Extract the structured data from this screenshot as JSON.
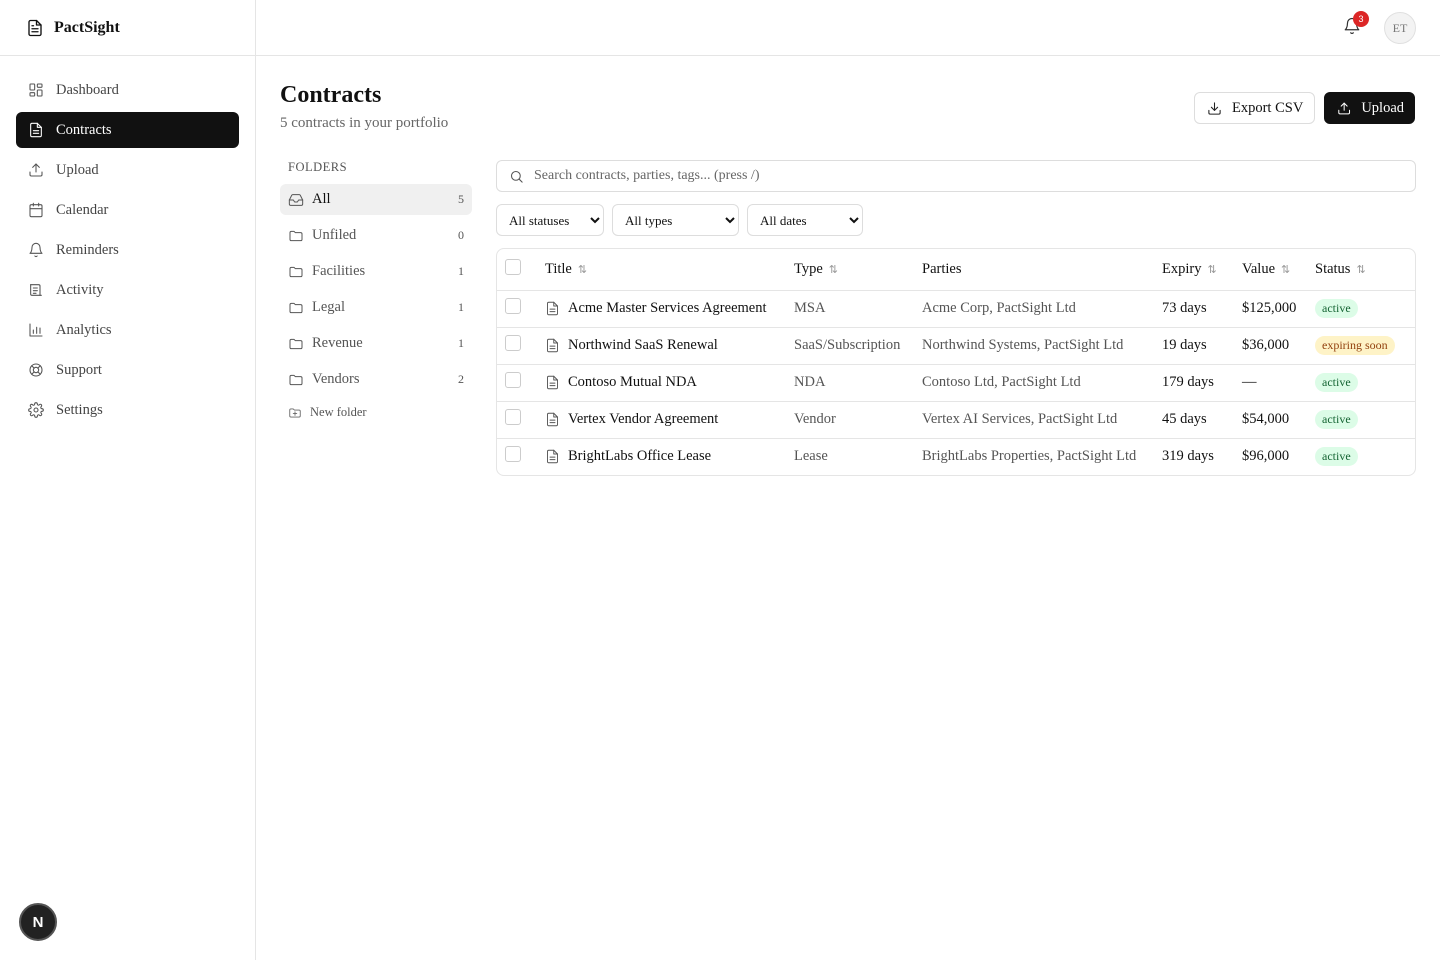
{
  "app": {
    "name": "PactSight"
  },
  "sidebar": {
    "items": [
      {
        "label": "Dashboard",
        "icon": "dashboard-icon"
      },
      {
        "label": "Contracts",
        "icon": "document-icon",
        "active": true
      },
      {
        "label": "Upload",
        "icon": "upload-icon"
      },
      {
        "label": "Calendar",
        "icon": "calendar-icon"
      },
      {
        "label": "Reminders",
        "icon": "bell-icon"
      },
      {
        "label": "Activity",
        "icon": "activity-icon"
      },
      {
        "label": "Analytics",
        "icon": "bar-chart-icon"
      },
      {
        "label": "Support",
        "icon": "lifebuoy-icon"
      },
      {
        "label": "Settings",
        "icon": "gear-icon"
      }
    ],
    "bottom_badge": "N"
  },
  "topbar": {
    "notification_count": "3",
    "avatar_initials": "ET"
  },
  "header": {
    "title": "Contracts",
    "subtitle": "5 contracts in your portfolio",
    "export_label": "Export CSV",
    "upload_label": "Upload"
  },
  "folders": {
    "heading": "FOLDERS",
    "items": [
      {
        "label": "All",
        "count": "5",
        "active": true
      },
      {
        "label": "Unfiled",
        "count": "0"
      },
      {
        "label": "Facilities",
        "count": "1"
      },
      {
        "label": "Legal",
        "count": "1"
      },
      {
        "label": "Revenue",
        "count": "1"
      },
      {
        "label": "Vendors",
        "count": "2"
      }
    ],
    "new_folder_label": "New folder"
  },
  "search": {
    "placeholder": "Search contracts, parties, tags... (press /)"
  },
  "filters": {
    "status": "All statuses",
    "type": "All types",
    "date": "All dates"
  },
  "table": {
    "columns": {
      "title": "Title",
      "type": "Type",
      "parties": "Parties",
      "expiry": "Expiry",
      "value": "Value",
      "status": "Status"
    },
    "rows": [
      {
        "title": "Acme Master Services Agreement",
        "type": "MSA",
        "parties": "Acme Corp, PactSight Ltd",
        "expiry": "73 days",
        "value": "$125,000",
        "status": "active"
      },
      {
        "title": "Northwind SaaS Renewal",
        "type": "SaaS/Subscription",
        "parties": "Northwind Systems, PactSight Ltd",
        "expiry": "19 days",
        "value": "$36,000",
        "status": "expiring soon"
      },
      {
        "title": "Contoso Mutual NDA",
        "type": "NDA",
        "parties": "Contoso Ltd, PactSight Ltd",
        "expiry": "179 days",
        "value": "—",
        "status": "active"
      },
      {
        "title": "Vertex Vendor Agreement",
        "type": "Vendor",
        "parties": "Vertex AI Services, PactSight Ltd",
        "expiry": "45 days",
        "value": "$54,000",
        "status": "active"
      },
      {
        "title": "BrightLabs Office Lease",
        "type": "Lease",
        "parties": "BrightLabs Properties, PactSight Ltd",
        "expiry": "319 days",
        "value": "$96,000",
        "status": "active"
      }
    ]
  },
  "colors": {
    "active_nav_bg": "#111111",
    "badge_active_bg": "#dcfce7",
    "badge_expiring_bg": "#fef3c7",
    "notification_red": "#dc2626"
  }
}
